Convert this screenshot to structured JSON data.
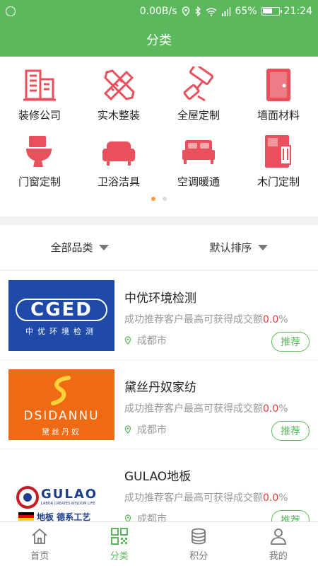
{
  "status": {
    "speed": "0.00B/s",
    "battery_pct": "65%",
    "battery_level": 0.65,
    "time": "21:24",
    "icons": [
      "location-icon",
      "bluetooth-icon",
      "wifi-icon",
      "signal-icon",
      "battery-icon"
    ]
  },
  "header": {
    "title": "分类"
  },
  "categories": [
    {
      "label": "装修公司",
      "icon": "building-icon"
    },
    {
      "label": "实木整装",
      "icon": "ruler-pencil-icon"
    },
    {
      "label": "全屋定制",
      "icon": "paint-roller-icon"
    },
    {
      "label": "墙面材料",
      "icon": "door-icon"
    },
    {
      "label": "门窗定制",
      "icon": "toilet-icon"
    },
    {
      "label": "卫浴洁具",
      "icon": "sofa-icon"
    },
    {
      "label": "空调暖通",
      "icon": "bed-icon"
    },
    {
      "label": "木门定制",
      "icon": "wardrobe-icon"
    }
  ],
  "pager": {
    "count": 2,
    "active": 0
  },
  "filters": {
    "category": "全部品类",
    "sort": "默认排序"
  },
  "accent": "#5cb85c",
  "icon_color": "#e8505b",
  "list": [
    {
      "name": "中优环境检测",
      "desc_prefix": "成功推荐客户最高可获得成交额",
      "pct": "0.0",
      "pct_suffix": "%",
      "city": "成都市",
      "button": "推荐",
      "logo": {
        "text": "CGED",
        "sub": "中优环境检测"
      }
    },
    {
      "name": "黛丝丹奴家纺",
      "desc_prefix": "成功推荐客户最高可获得成交额",
      "pct": "0.0",
      "pct_suffix": "%",
      "city": "成都市",
      "button": "推荐",
      "logo": {
        "text": "DSIDANNU",
        "sub": "黛丝丹奴"
      }
    },
    {
      "name": "GULAO地板",
      "desc_prefix": "成功推荐客户最高可获得成交额",
      "pct": "0.0",
      "pct_suffix": "%",
      "city": "成都市",
      "button": "推荐",
      "logo": {
        "text": "GULAO",
        "tag": "LABOR CREATES WISDOM LIFE",
        "sub": "地板 德系工艺"
      }
    }
  ],
  "tabs": [
    {
      "label": "首页",
      "icon": "home-icon"
    },
    {
      "label": "分类",
      "icon": "grid-icon"
    },
    {
      "label": "积分",
      "icon": "coins-icon"
    },
    {
      "label": "我的",
      "icon": "user-icon"
    }
  ]
}
